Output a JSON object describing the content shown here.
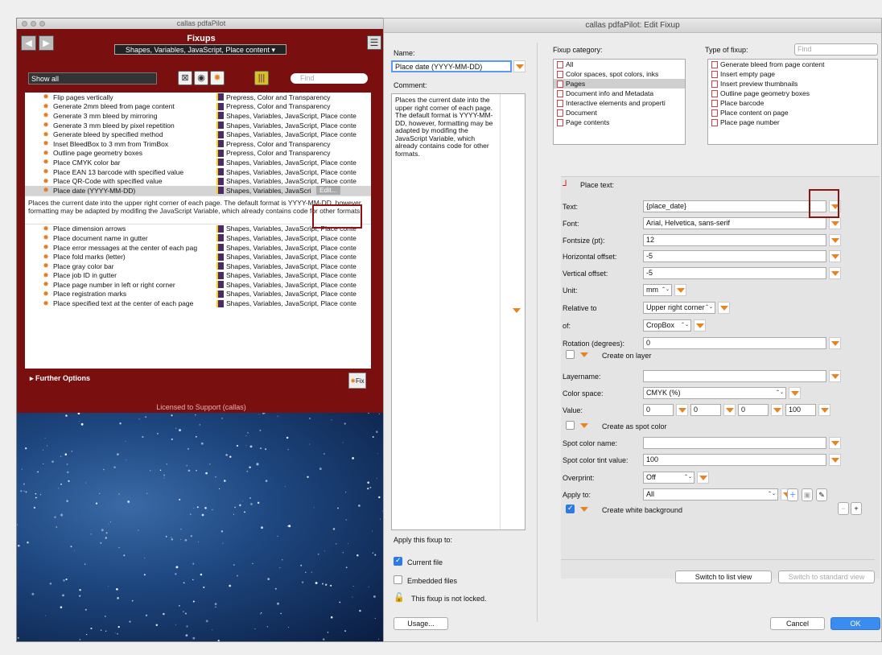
{
  "left": {
    "title": "callas pdfaPilot",
    "header": "Fixups",
    "filter": "Shapes, Variables, JavaScript, Place content ▾",
    "show": "Show all",
    "find": "Find",
    "rows": [
      {
        "name": "Flip pages vertically",
        "cat": "Prepress, Color and Transparency"
      },
      {
        "name": "Generate 2mm bleed from page content",
        "cat": "Prepress, Color and Transparency"
      },
      {
        "name": "Generate 3 mm bleed by mirroring",
        "cat": "Shapes, Variables, JavaScript, Place conte"
      },
      {
        "name": "Generate 3 mm bleed by pixel repetition",
        "cat": "Shapes, Variables, JavaScript, Place conte"
      },
      {
        "name": "Generate bleed by specified method",
        "cat": "Shapes, Variables, JavaScript, Place conte"
      },
      {
        "name": "Inset BleedBox to 3 mm from TrimBox",
        "cat": "Prepress, Color and Transparency"
      },
      {
        "name": "Outline page geometry boxes",
        "cat": "Prepress, Color and Transparency"
      },
      {
        "name": "Place CMYK color bar",
        "cat": "Shapes, Variables, JavaScript, Place conte"
      },
      {
        "name": "Place EAN 13 barcode with specified value",
        "cat": "Shapes, Variables, JavaScript, Place conte"
      },
      {
        "name": "Place QR-Code with specified value",
        "cat": "Shapes, Variables, JavaScript, Place conte"
      }
    ],
    "selected": {
      "name": "Place date (YYYY-MM-DD)",
      "cat": "Shapes, Variables, JavaScri",
      "edit": "Edit..."
    },
    "description": "Places the current date into the upper right corner of each page. The default format is YYYY-MM-DD, however, formatting may be adapted by modifing the JavaScript Variable, which already contains code for other formats.",
    "rows2": [
      {
        "name": "Place dimension arrows",
        "cat": "Shapes, Variables, JavaScript, Place conte"
      },
      {
        "name": "Place document name in gutter",
        "cat": "Shapes, Variables, JavaScript, Place conte"
      },
      {
        "name": "Place error messages at the center of each pag",
        "cat": "Shapes, Variables, JavaScript, Place conte"
      },
      {
        "name": "Place fold marks (letter)",
        "cat": "Shapes, Variables, JavaScript, Place conte"
      },
      {
        "name": "Place gray color bar",
        "cat": "Shapes, Variables, JavaScript, Place conte"
      },
      {
        "name": "Place job ID in gutter",
        "cat": "Shapes, Variables, JavaScript, Place conte"
      },
      {
        "name": "Place page number in left or right corner",
        "cat": "Shapes, Variables, JavaScript, Place conte"
      },
      {
        "name": "Place registration marks",
        "cat": "Shapes, Variables, JavaScript, Place conte"
      },
      {
        "name": "Place specified text at the center of each page",
        "cat": "Shapes, Variables, JavaScript, Place conte"
      }
    ],
    "further": "Further Options",
    "fix": "Fix",
    "licensed": "Licensed to Support (callas)"
  },
  "dialog": {
    "title": "callas pdfaPilot: Edit Fixup",
    "name_label": "Name:",
    "name_value": "Place date (YYYY-MM-DD)",
    "comment_label": "Comment:",
    "comment_value": "Places the current date into the upper right corner of each page. The default format is YYYY-MM-DD, however, formatting may be adapted by modifing the JavaScript Variable, which already contains code for other formats.",
    "category_label": "Fixup category:",
    "categories": [
      "All",
      "Color spaces, spot colors, inks",
      "Pages",
      "Document info and Metadata",
      "Interactive elements and properti",
      "Document",
      "Page contents"
    ],
    "type_label": "Type of fixup:",
    "type_find": "Find",
    "types": [
      "Generate bleed from page content",
      "Insert empty page",
      "Insert preview thumbnails",
      "Outline page geometry boxes",
      "Place barcode",
      "Place content on page",
      "Place page number"
    ],
    "section": "Place text:",
    "fields": {
      "text_l": "Text:",
      "text_v": "{place_date}",
      "font_l": "Font:",
      "font_v": "Arial, Helvetica, sans-serif",
      "size_l": "Fontsize (pt):",
      "size_v": "12",
      "hoff_l": "Horizontal offset:",
      "hoff_v": "-5",
      "voff_l": "Vertical offset:",
      "voff_v": "-5",
      "unit_l": "Unit:",
      "unit_v": "mm",
      "rel_l": "Relative to",
      "rel_v": "Upper right corner",
      "of_l": "of:",
      "of_v": "CropBox",
      "rot_l": "Rotation (degrees):",
      "rot_v": "0",
      "layer_cb": "Create on layer",
      "layername_l": "Layername:",
      "cs_l": "Color space:",
      "cs_v": "CMYK (%)",
      "val_l": "Value:",
      "v1": "0",
      "v2": "0",
      "v3": "0",
      "v4": "100",
      "spot_cb": "Create as spot color",
      "spotname_l": "Spot color name:",
      "tint_l": "Spot color tint value:",
      "tint_v": "100",
      "op_l": "Overprint:",
      "op_v": "Off",
      "apply_l": "Apply to:",
      "apply_v": "All",
      "white_cb": "Create white background"
    },
    "apply_label": "Apply this fixup to:",
    "current_file": "Current file",
    "embedded": "Embedded files",
    "lock_text": "This fixup is not locked.",
    "usage": "Usage...",
    "switch_list": "Switch to list view",
    "switch_std": "Switch to standard view",
    "cancel": "Cancel",
    "ok": "OK",
    "minus": "−",
    "plus": "+"
  },
  "colors": {
    "accent": "#e8841f",
    "maroon": "#7a0f0f",
    "highlight": "#8d1212",
    "blue": "#3a8cf0"
  }
}
